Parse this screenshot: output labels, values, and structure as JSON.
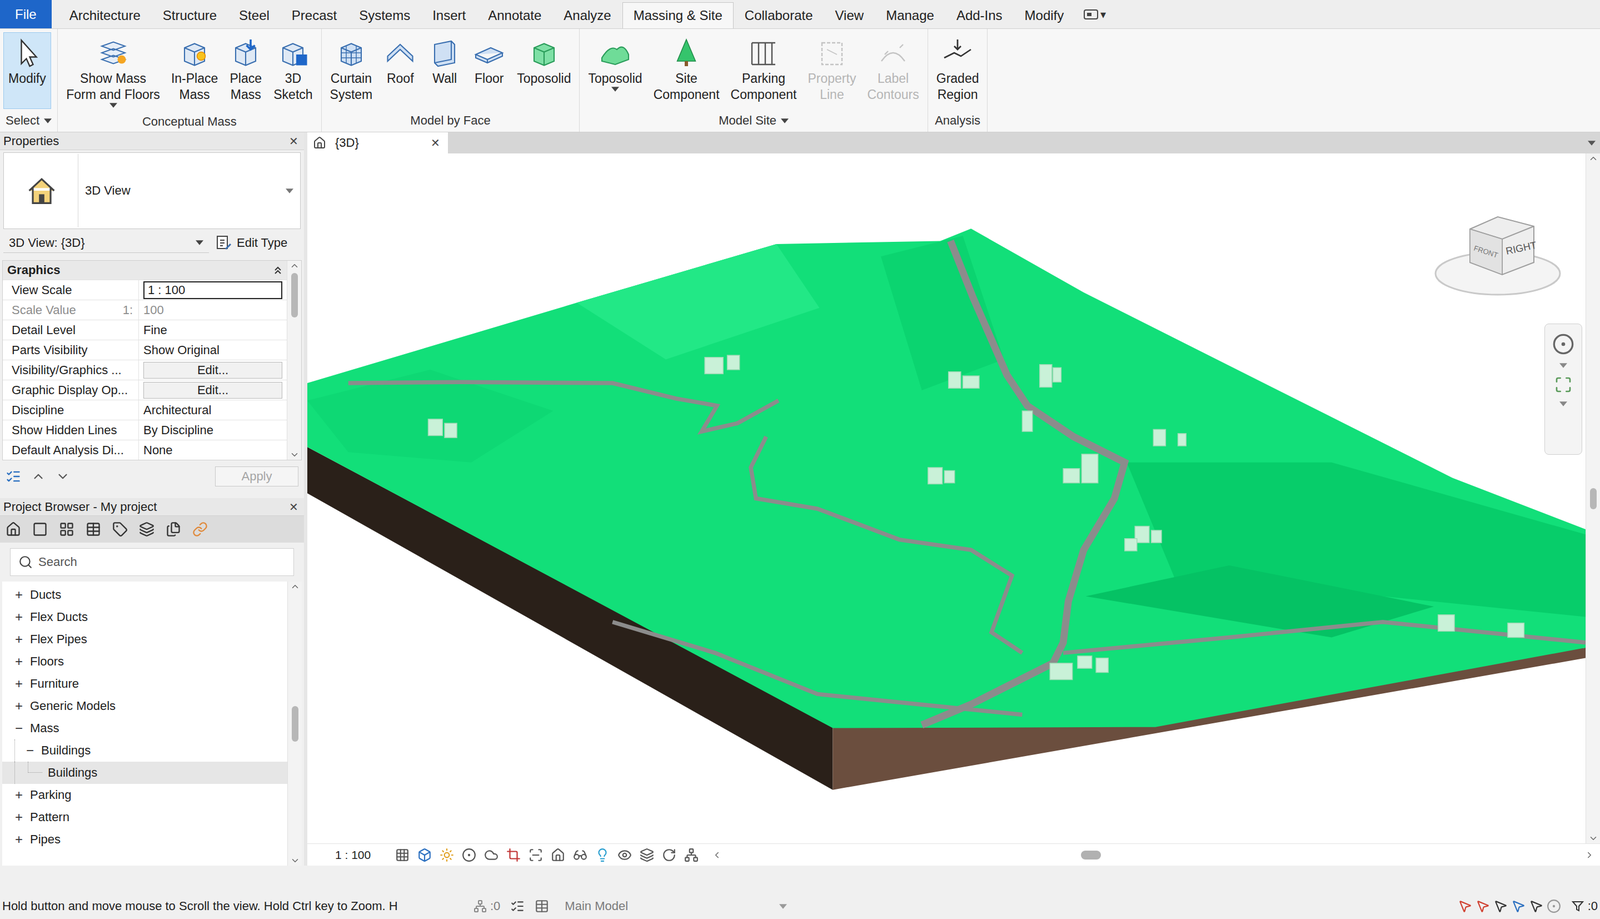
{
  "menu": {
    "tabs": [
      {
        "label": "File",
        "kind": "file",
        "selected": false
      },
      {
        "label": "Architecture",
        "kind": "tab",
        "selected": false
      },
      {
        "label": "Structure",
        "kind": "tab",
        "selected": false
      },
      {
        "label": "Steel",
        "kind": "tab",
        "selected": false
      },
      {
        "label": "Precast",
        "kind": "tab",
        "selected": false
      },
      {
        "label": "Systems",
        "kind": "tab",
        "selected": false
      },
      {
        "label": "Insert",
        "kind": "tab",
        "selected": false
      },
      {
        "label": "Annotate",
        "kind": "tab",
        "selected": false
      },
      {
        "label": "Analyze",
        "kind": "tab",
        "selected": false
      },
      {
        "label": "Massing & Site",
        "kind": "tab",
        "selected": true
      },
      {
        "label": "Collaborate",
        "kind": "tab",
        "selected": false
      },
      {
        "label": "View",
        "kind": "tab",
        "selected": false
      },
      {
        "label": "Manage",
        "kind": "tab",
        "selected": false
      },
      {
        "label": "Add-Ins",
        "kind": "tab",
        "selected": false
      },
      {
        "label": "Modify",
        "kind": "tab",
        "selected": false
      }
    ],
    "extra": "▾"
  },
  "ribbon": {
    "panels": [
      {
        "title": "Select",
        "dropdown": true,
        "buttons": [
          {
            "label": "Modify",
            "selected": true,
            "disabled": false,
            "dropdown": false
          }
        ]
      },
      {
        "title": "Conceptual Mass",
        "dropdown": false,
        "buttons": [
          {
            "label": "Show Mass\nForm and Floors",
            "selected": false,
            "disabled": false,
            "dropdown": true
          },
          {
            "label": "In-Place\nMass",
            "selected": false,
            "disabled": false,
            "dropdown": false
          },
          {
            "label": "Place\nMass",
            "selected": false,
            "disabled": false,
            "dropdown": false
          },
          {
            "label": "3D\nSketch",
            "selected": false,
            "disabled": false,
            "dropdown": false
          }
        ]
      },
      {
        "title": "Model by Face",
        "dropdown": false,
        "buttons": [
          {
            "label": "Curtain\nSystem",
            "selected": false,
            "disabled": false,
            "dropdown": false
          },
          {
            "label": "Roof",
            "selected": false,
            "disabled": false,
            "dropdown": false
          },
          {
            "label": "Wall",
            "selected": false,
            "disabled": false,
            "dropdown": false
          },
          {
            "label": "Floor",
            "selected": false,
            "disabled": false,
            "dropdown": false
          },
          {
            "label": "Toposolid",
            "selected": false,
            "disabled": false,
            "dropdown": false
          }
        ]
      },
      {
        "title": "Model Site",
        "dropdown": true,
        "buttons": [
          {
            "label": "Toposolid",
            "selected": false,
            "disabled": false,
            "dropdown": true
          },
          {
            "label": "Site\nComponent",
            "selected": false,
            "disabled": false,
            "dropdown": false
          },
          {
            "label": "Parking\nComponent",
            "selected": false,
            "disabled": false,
            "dropdown": false
          },
          {
            "label": "Property\nLine",
            "selected": false,
            "disabled": true,
            "dropdown": false
          },
          {
            "label": "Label\nContours",
            "selected": false,
            "disabled": true,
            "dropdown": false
          }
        ]
      },
      {
        "title": "Analysis",
        "dropdown": false,
        "buttons": [
          {
            "label": "Graded\nRegion",
            "selected": false,
            "disabled": false,
            "dropdown": false
          }
        ]
      }
    ]
  },
  "properties": {
    "title": "Properties",
    "close": "✕",
    "type": "3D View",
    "instance": "3D View: {3D}",
    "edit_type": "Edit Type",
    "group": "Graphics",
    "rows": [
      {
        "label": "View Scale",
        "suffix": "",
        "value": "1 : 100",
        "kind": "input"
      },
      {
        "label": "Scale Value",
        "suffix": "1:",
        "value": "100",
        "kind": "readonly"
      },
      {
        "label": "Detail Level",
        "suffix": "",
        "value": "Fine",
        "kind": "text"
      },
      {
        "label": "Parts Visibility",
        "suffix": "",
        "value": "Show Original",
        "kind": "text"
      },
      {
        "label": "Visibility/Graphics ...",
        "suffix": "",
        "value": "Edit...",
        "kind": "button"
      },
      {
        "label": "Graphic Display Op...",
        "suffix": "",
        "value": "Edit...",
        "kind": "button"
      },
      {
        "label": "Discipline",
        "suffix": "",
        "value": "Architectural",
        "kind": "text"
      },
      {
        "label": "Show Hidden Lines",
        "suffix": "",
        "value": "By Discipline",
        "kind": "text"
      },
      {
        "label": "Default Analysis Di...",
        "suffix": "",
        "value": "None",
        "kind": "text"
      }
    ],
    "apply": {
      "label": "Apply",
      "disabled": true
    }
  },
  "browser": {
    "title": "Project Browser - My project",
    "close": "✕",
    "search": {
      "placeholder": "Search"
    },
    "items": [
      {
        "label": "Ducts",
        "toggle": "+",
        "level": 0,
        "expanded": false,
        "selected": false
      },
      {
        "label": "Flex Ducts",
        "toggle": "+",
        "level": 0,
        "expanded": false,
        "selected": false
      },
      {
        "label": "Flex Pipes",
        "toggle": "+",
        "level": 0,
        "expanded": false,
        "selected": false
      },
      {
        "label": "Floors",
        "toggle": "+",
        "level": 0,
        "expanded": false,
        "selected": false
      },
      {
        "label": "Furniture",
        "toggle": "+",
        "level": 0,
        "expanded": false,
        "selected": false
      },
      {
        "label": "Generic Models",
        "toggle": "+",
        "level": 0,
        "expanded": false,
        "selected": false
      },
      {
        "label": "Mass",
        "toggle": "−",
        "level": 0,
        "expanded": true,
        "selected": false
      },
      {
        "label": "Buildings",
        "toggle": "−",
        "level": 1,
        "expanded": true,
        "selected": false
      },
      {
        "label": "Buildings",
        "toggle": "",
        "level": 2,
        "expanded": false,
        "selected": true
      },
      {
        "label": "Parking",
        "toggle": "+",
        "level": 0,
        "expanded": false,
        "selected": false
      },
      {
        "label": "Pattern",
        "toggle": "+",
        "level": 0,
        "expanded": false,
        "selected": false
      },
      {
        "label": "Pipes",
        "toggle": "+",
        "level": 0,
        "expanded": false,
        "selected": false
      }
    ]
  },
  "view": {
    "tab": {
      "label": "{3D}",
      "close": "✕",
      "selected": true
    },
    "scale": "1 : 100",
    "viewcube": {
      "front": "FRONT",
      "right": "RIGHT"
    }
  },
  "status_bar": {
    "message": "Hold button and move mouse to Scroll the view. Hold Ctrl key to Zoom. H",
    "worksets": ":0",
    "model": "Main Model",
    "filter": ":0"
  }
}
